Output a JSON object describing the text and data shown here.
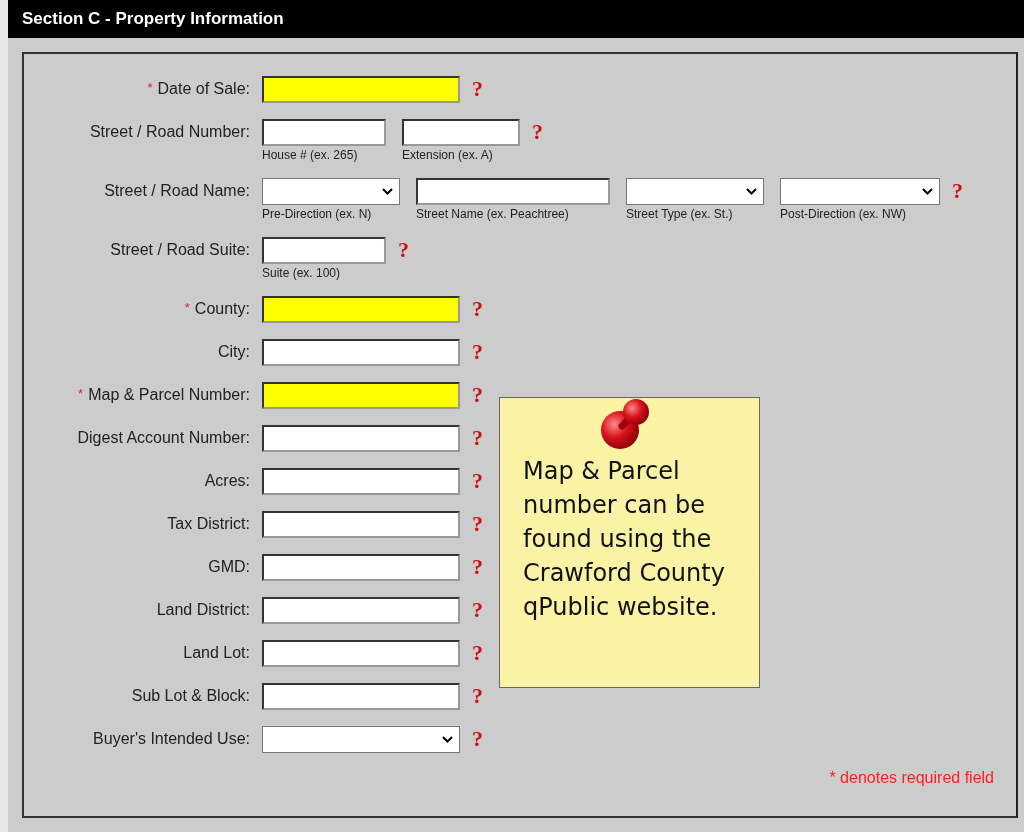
{
  "header": {
    "title": "Section C - Property Information"
  },
  "rows": [
    {
      "label": "Date of Sale:",
      "required_mark": "*",
      "help": "?",
      "fields": [
        {
          "kind": "text",
          "highlighted": true
        }
      ]
    },
    {
      "label": "Street / Road Number:",
      "help": "?",
      "fields": [
        {
          "kind": "text",
          "highlighted": false,
          "caption": "House # (ex. 265)"
        },
        {
          "kind": "text",
          "highlighted": false,
          "caption": "Extension (ex. A)"
        }
      ]
    },
    {
      "label": "Street / Road Name:",
      "help": "?",
      "fields": [
        {
          "kind": "select",
          "highlighted": false,
          "caption": "Pre-Direction (ex. N)"
        },
        {
          "kind": "text",
          "highlighted": false,
          "caption": "Street Name (ex. Peachtree)"
        },
        {
          "kind": "select",
          "highlighted": false,
          "caption": "Street Type (ex. St.)"
        },
        {
          "kind": "select",
          "highlighted": false,
          "caption": "Post-Direction (ex. NW)"
        }
      ]
    },
    {
      "label": "Street / Road Suite:",
      "help": "?",
      "fields": [
        {
          "kind": "text",
          "highlighted": false,
          "caption": "Suite (ex. 100)"
        }
      ]
    },
    {
      "label": "County:",
      "required_mark": "*",
      "help": "?",
      "fields": [
        {
          "kind": "text",
          "highlighted": true
        }
      ]
    },
    {
      "label": "City:",
      "help": "?",
      "fields": [
        {
          "kind": "text",
          "highlighted": false
        }
      ]
    },
    {
      "label": "Map & Parcel Number:",
      "required_mark": "*",
      "help": "?",
      "fields": [
        {
          "kind": "text",
          "highlighted": true
        }
      ]
    },
    {
      "label": "Digest Account Number:",
      "help": "?",
      "fields": [
        {
          "kind": "text",
          "highlighted": false
        }
      ]
    },
    {
      "label": "Acres:",
      "help": "?",
      "fields": [
        {
          "kind": "text",
          "highlighted": false
        }
      ]
    },
    {
      "label": "Tax District:",
      "help": "?",
      "fields": [
        {
          "kind": "text",
          "highlighted": false
        }
      ]
    },
    {
      "label": "GMD:",
      "help": "?",
      "fields": [
        {
          "kind": "text",
          "highlighted": false
        }
      ]
    },
    {
      "label": "Land District:",
      "help": "?",
      "fields": [
        {
          "kind": "text",
          "highlighted": false
        }
      ]
    },
    {
      "label": "Land Lot:",
      "help": "?",
      "fields": [
        {
          "kind": "text",
          "highlighted": false
        }
      ]
    },
    {
      "label": "Sub Lot & Block:",
      "help": "?",
      "fields": [
        {
          "kind": "text",
          "highlighted": false
        }
      ]
    },
    {
      "label": "Buyer's Intended Use:",
      "help": "?",
      "fields": [
        {
          "kind": "select",
          "highlighted": false
        }
      ]
    }
  ],
  "note": {
    "text": "Map & Parcel number can be found using the Crawford County qPublic website."
  },
  "footer": {
    "text": "* denotes required field"
  }
}
